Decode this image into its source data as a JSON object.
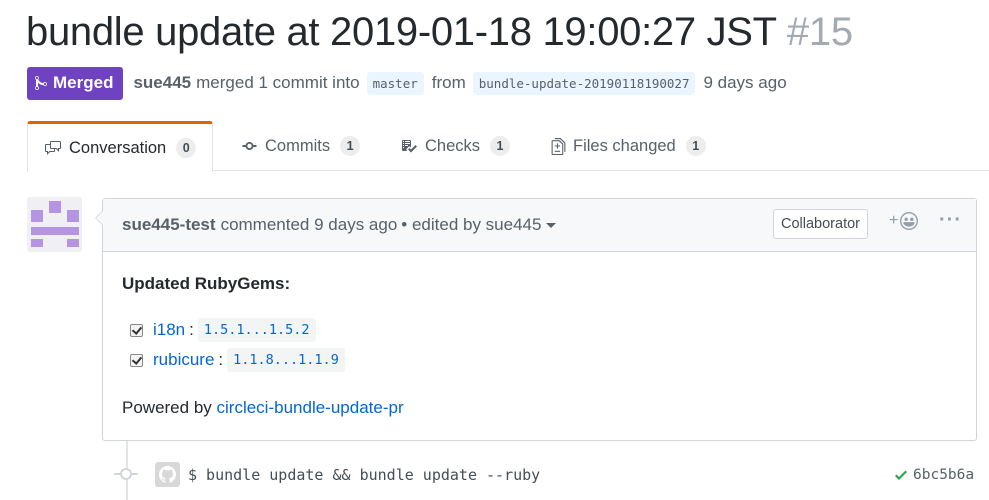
{
  "pull_request": {
    "title": "bundle update at 2019-01-18 19:00:27 JST",
    "number": "#15",
    "state": "Merged",
    "state_color": "#6f42c1",
    "author": "sue445",
    "merge_text": "merged 1 commit into",
    "base_branch": "master",
    "from_text": "from",
    "head_branch": "bundle-update-20190118190027",
    "age": "9 days ago"
  },
  "tabs": [
    {
      "label": "Conversation",
      "count": "0",
      "icon": "comment-discussion-icon",
      "selected": true
    },
    {
      "label": "Commits",
      "count": "1",
      "icon": "git-commit-icon",
      "selected": false
    },
    {
      "label": "Checks",
      "count": "1",
      "icon": "checklist-icon",
      "selected": false
    },
    {
      "label": "Files changed",
      "count": "1",
      "icon": "file-diff-icon",
      "selected": false
    }
  ],
  "comment": {
    "author": "sue445-test",
    "action": "commented 9 days ago",
    "edited": "• edited by sue445",
    "role": "Collaborator",
    "reaction_icon": "smiley-icon",
    "more_icon": "kebab-horizontal-icon",
    "heading": "Updated RubyGems:",
    "gems": [
      {
        "name": "i18n",
        "range": "1.5.1...1.5.2",
        "checked": true
      },
      {
        "name": "rubicure",
        "range": "1.1.8...1.1.9",
        "checked": true
      }
    ],
    "powered_by_text": "Powered by",
    "powered_by_link": "circleci-bundle-update-pr"
  },
  "commit": {
    "message": "$ bundle update && bundle update --ruby",
    "status": "success",
    "status_color": "#28a745",
    "sha": "6bc5b6a"
  }
}
